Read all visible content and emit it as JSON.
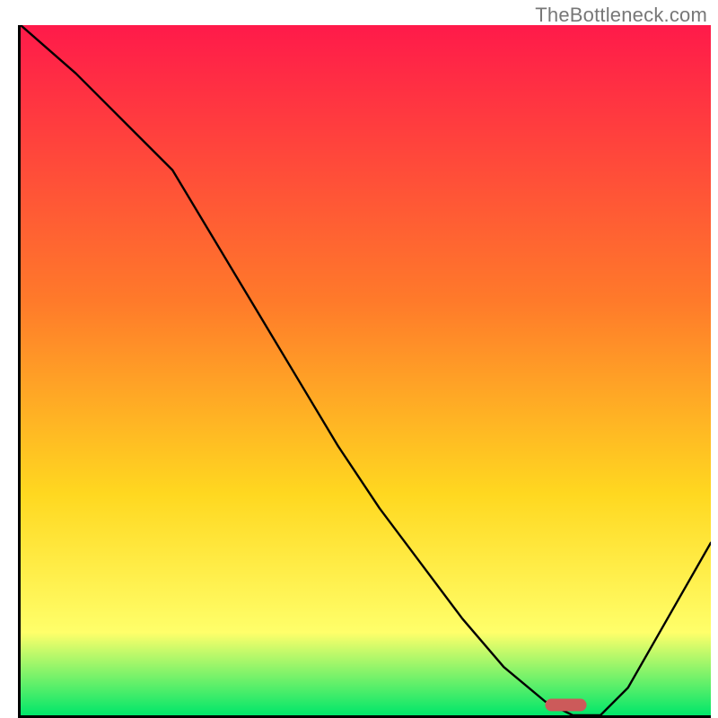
{
  "watermark": "TheBottleneck.com",
  "colors": {
    "gradient_top": "#ff1a4a",
    "gradient_mid1": "#ff7a2a",
    "gradient_mid2": "#ffd820",
    "gradient_mid3": "#ffff6a",
    "gradient_bottom": "#00e66a",
    "axis": "#000000",
    "curve": "#000000",
    "marker_fill": "#cc5a5a"
  },
  "chart_data": {
    "type": "line",
    "title": "",
    "xlabel": "",
    "ylabel": "",
    "xlim": [
      0,
      100
    ],
    "ylim": [
      0,
      100
    ],
    "grid": false,
    "legend": "none",
    "x": [
      0,
      8,
      16,
      22,
      28,
      34,
      40,
      46,
      52,
      58,
      64,
      70,
      76,
      80,
      84,
      88,
      92,
      96,
      100
    ],
    "values": [
      100,
      93,
      85,
      79,
      69,
      59,
      49,
      39,
      30,
      22,
      14,
      7,
      2,
      0,
      0,
      4,
      11,
      18,
      25
    ],
    "marker": {
      "x_start": 76,
      "x_end": 82,
      "y": 1.2
    },
    "annotations": []
  }
}
